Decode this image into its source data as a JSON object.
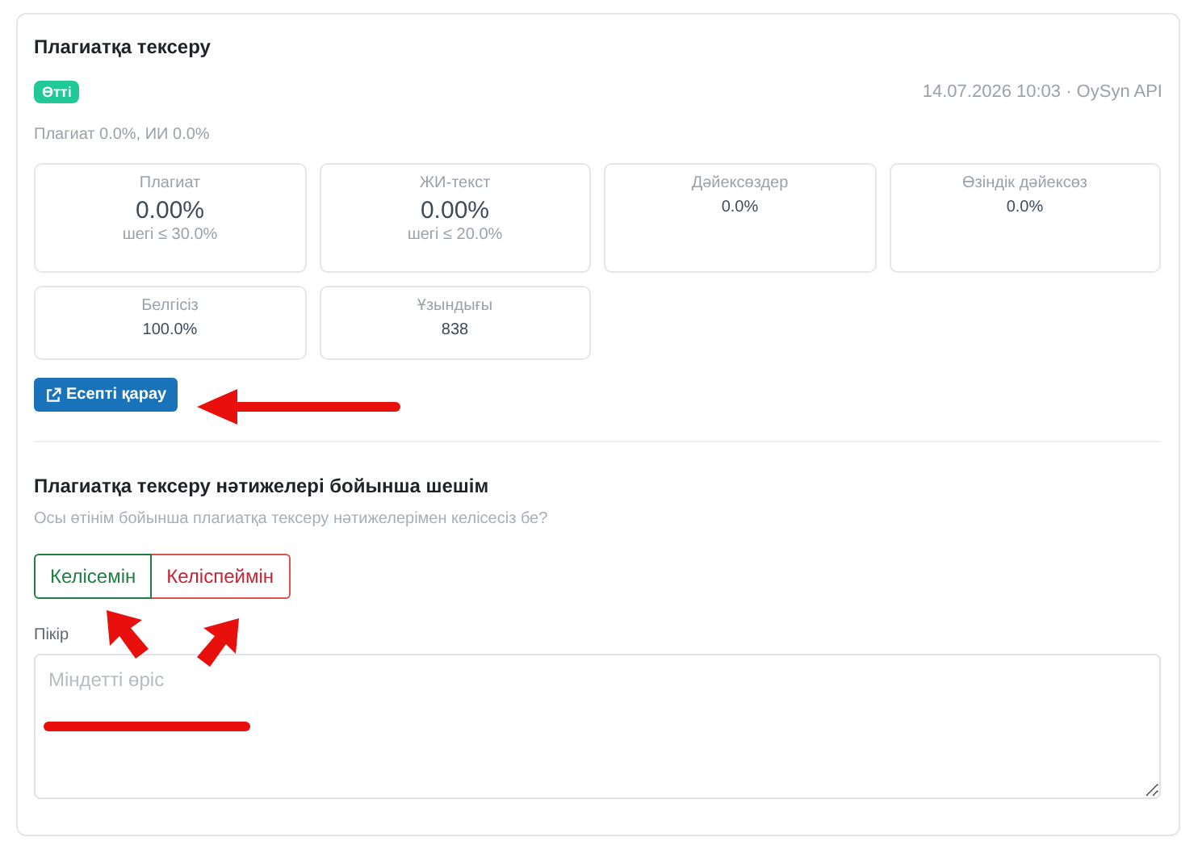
{
  "card": {
    "title": "Плагиатқа тексеру",
    "status_badge": "Өтті",
    "meta": "14.07.2026 10:03 · OySyn API",
    "summary": "Плагиат 0.0%, ИИ 0.0%"
  },
  "stats": [
    {
      "kind": "main",
      "label": "Плагиат",
      "value": "0.00%",
      "limit": "шегі ≤ 30.0%"
    },
    {
      "kind": "main",
      "label": "ЖИ-текст",
      "value": "0.00%",
      "limit": "шегі ≤ 20.0%"
    },
    {
      "kind": "small",
      "label": "Дәйексөздер",
      "value": "0.0%"
    },
    {
      "kind": "small",
      "label": "Өзіндік дәйексөз",
      "value": "0.0%"
    },
    {
      "kind": "small",
      "label": "Белгісіз",
      "value": "100.0%"
    },
    {
      "kind": "small",
      "label": "Ұзындығы",
      "value": "838"
    }
  ],
  "report_button": "Есепті қарау",
  "decision": {
    "title": "Плагиатқа тексеру нәтижелері бойынша шешім",
    "question": "Осы өтінім бойынша плагиатқа тексеру нәтижелерімен келісесіз бе?",
    "options": [
      {
        "kind": "agree",
        "label": "Келісемін",
        "selected": false
      },
      {
        "kind": "disagree",
        "label": "Келіспеймін",
        "selected": false
      }
    ],
    "comment_label": "Пікір",
    "comment_placeholder": "Міндетті өріс"
  },
  "annotations": [
    {
      "kind": "arrow"
    },
    {
      "kind": "cursor"
    },
    {
      "kind": "cursor"
    },
    {
      "kind": "underline"
    }
  ]
}
